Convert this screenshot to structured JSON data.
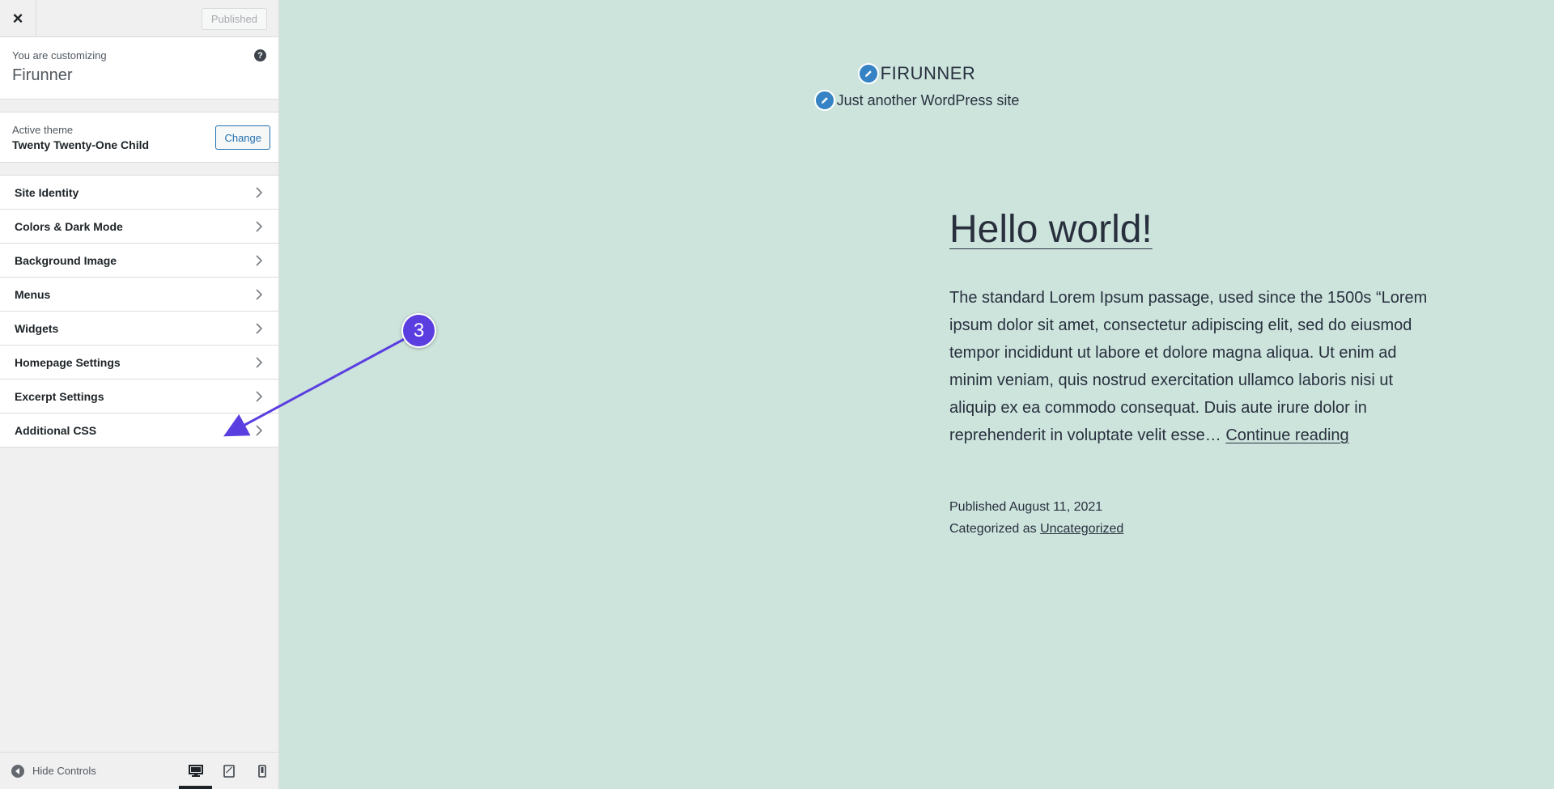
{
  "topbar": {
    "close_label": "×",
    "publish_label": "Published"
  },
  "info": {
    "customizing_label": "You are customizing",
    "site_name": "Firunner",
    "help_label": "?"
  },
  "theme": {
    "active_label": "Active theme",
    "name": "Twenty Twenty-One Child",
    "change_label": "Change"
  },
  "sections": [
    {
      "label": "Site Identity"
    },
    {
      "label": "Colors & Dark Mode"
    },
    {
      "label": "Background Image"
    },
    {
      "label": "Menus"
    },
    {
      "label": "Widgets"
    },
    {
      "label": "Homepage Settings"
    },
    {
      "label": "Excerpt Settings"
    },
    {
      "label": "Additional CSS"
    }
  ],
  "footer": {
    "hide_controls_label": "Hide Controls",
    "devices": [
      "desktop-icon",
      "tablet-icon",
      "mobile-icon"
    ],
    "active_device": "desktop-icon"
  },
  "preview": {
    "site_title": "FIRUNNER",
    "tagline": "Just another WordPress site",
    "post_title": "Hello world!",
    "post_excerpt": "The standard Lorem Ipsum passage, used since the 1500s “Lorem ipsum dolor sit amet, consectetur adipiscing elit, sed do eiusmod tempor incididunt ut labore et dolore magna aliqua. Ut enim ad minim veniam, quis nostrud exercitation ullamco laboris nisi ut aliquip ex ea commodo consequat. Duis aute irure dolor in reprehenderit in voluptate velit esse…",
    "continue_label": "Continue reading",
    "published_text": "Published August 11, 2021",
    "categorized_prefix": "Categorized as",
    "category": "Uncategorized"
  },
  "annotation": {
    "step_number": "3",
    "color": "#5b3ee0"
  },
  "colors": {
    "preview_background": "#cde4dd",
    "accent": "#2271b1",
    "edit_shortcut": "#3582c4"
  }
}
